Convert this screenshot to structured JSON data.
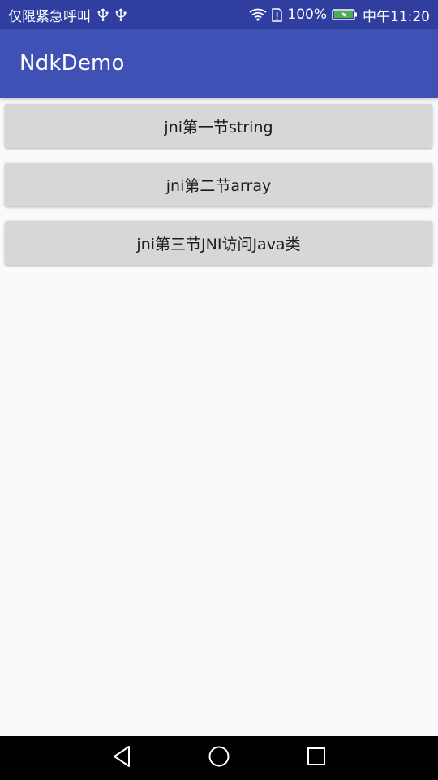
{
  "status_bar": {
    "left_text": "仅限紧急呼叫",
    "battery": "100%",
    "time": "中午11:20",
    "icons": [
      "usb-icon",
      "usb-icon",
      "wifi-icon",
      "sim-icon",
      "battery-icon"
    ]
  },
  "app_bar": {
    "title": "NdkDemo"
  },
  "buttons": [
    {
      "label": "jni第一节string"
    },
    {
      "label": "jni第二节array"
    },
    {
      "label": "jni第三节JNI访问Java类"
    }
  ],
  "nav_bar": {
    "icons": [
      "back-icon",
      "home-icon",
      "recent-apps-icon"
    ]
  },
  "colors": {
    "status_bar": "#303f9f",
    "app_bar": "#3f51b5",
    "button": "#d6d7d7",
    "background": "#fafafa"
  }
}
